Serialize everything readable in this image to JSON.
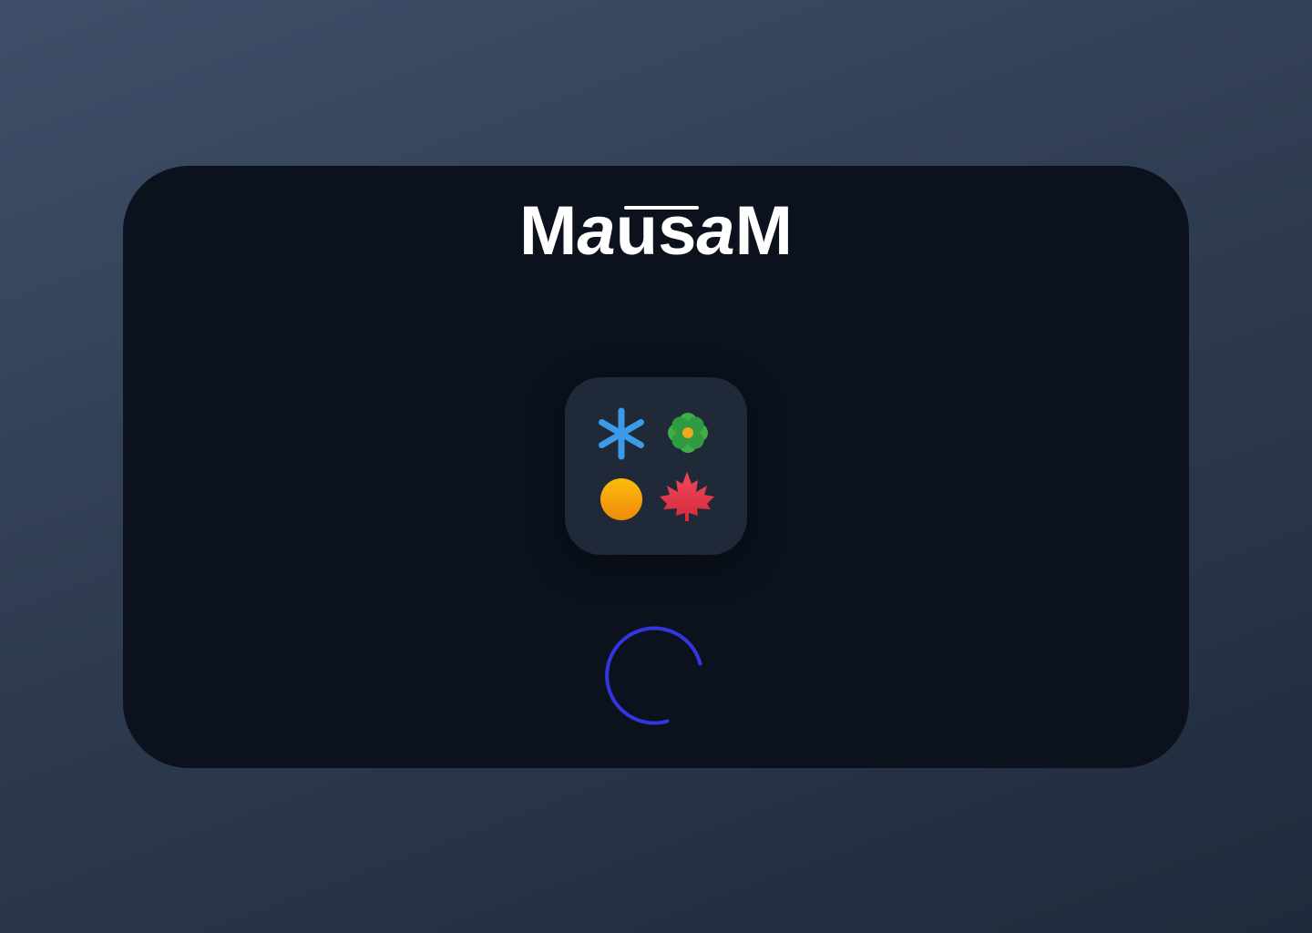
{
  "app": {
    "logo_prefix": "M",
    "logo_middle": "au",
    "logo_italic": "a",
    "logo_s": "s",
    "logo_suffix": "M",
    "logo_full": "MausaM"
  },
  "icons": {
    "winter": "snowflake-icon",
    "spring": "flower-icon",
    "summer": "sun-icon",
    "autumn": "maple-leaf-icon"
  },
  "colors": {
    "background_top": "#3f4f69",
    "background_bottom": "#1f2a3b",
    "card": "#0b121e",
    "icon_tile": "#1f2937",
    "snowflake": "#3b9be8",
    "flower": "#3fae49",
    "flower_center": "#f2a81d",
    "sun": "#f7a70b",
    "maple": "#e23a4a",
    "spinner": "#3535e0"
  },
  "loading": {
    "state": "loading"
  }
}
